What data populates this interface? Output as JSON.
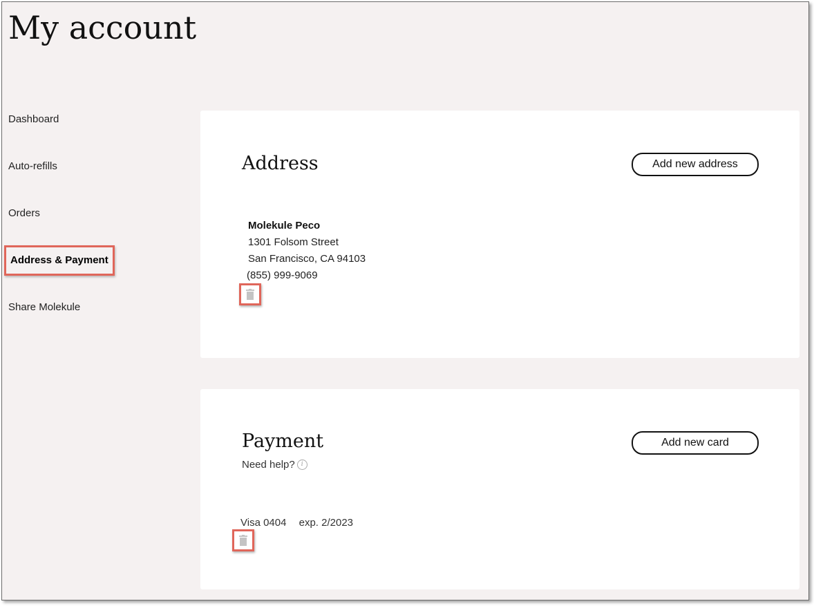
{
  "page": {
    "title": "My account"
  },
  "sidebar": {
    "items": [
      {
        "label": "Dashboard"
      },
      {
        "label": "Auto-refills"
      },
      {
        "label": "Orders"
      },
      {
        "label": "Address & Payment",
        "active": true
      },
      {
        "label": "Share Molekule"
      }
    ]
  },
  "address": {
    "heading": "Address",
    "add_button": "Add new address",
    "entry": {
      "name": "Molekule Peco",
      "street": "1301 Folsom Street",
      "city_line": "San Francisco, CA 94103",
      "phone": "(855) 999-9069"
    },
    "delete_icon": "trash-icon"
  },
  "payment": {
    "heading": "Payment",
    "add_button": "Add new card",
    "help_text": "Need help?",
    "help_icon": "info-icon",
    "card": {
      "label": "Visa 0404",
      "expiry": "exp. 2/2023"
    },
    "delete_icon": "trash-icon"
  },
  "colors": {
    "background": "#f5f1f1",
    "highlight": "#e0665a",
    "card_bg": "#ffffff"
  }
}
